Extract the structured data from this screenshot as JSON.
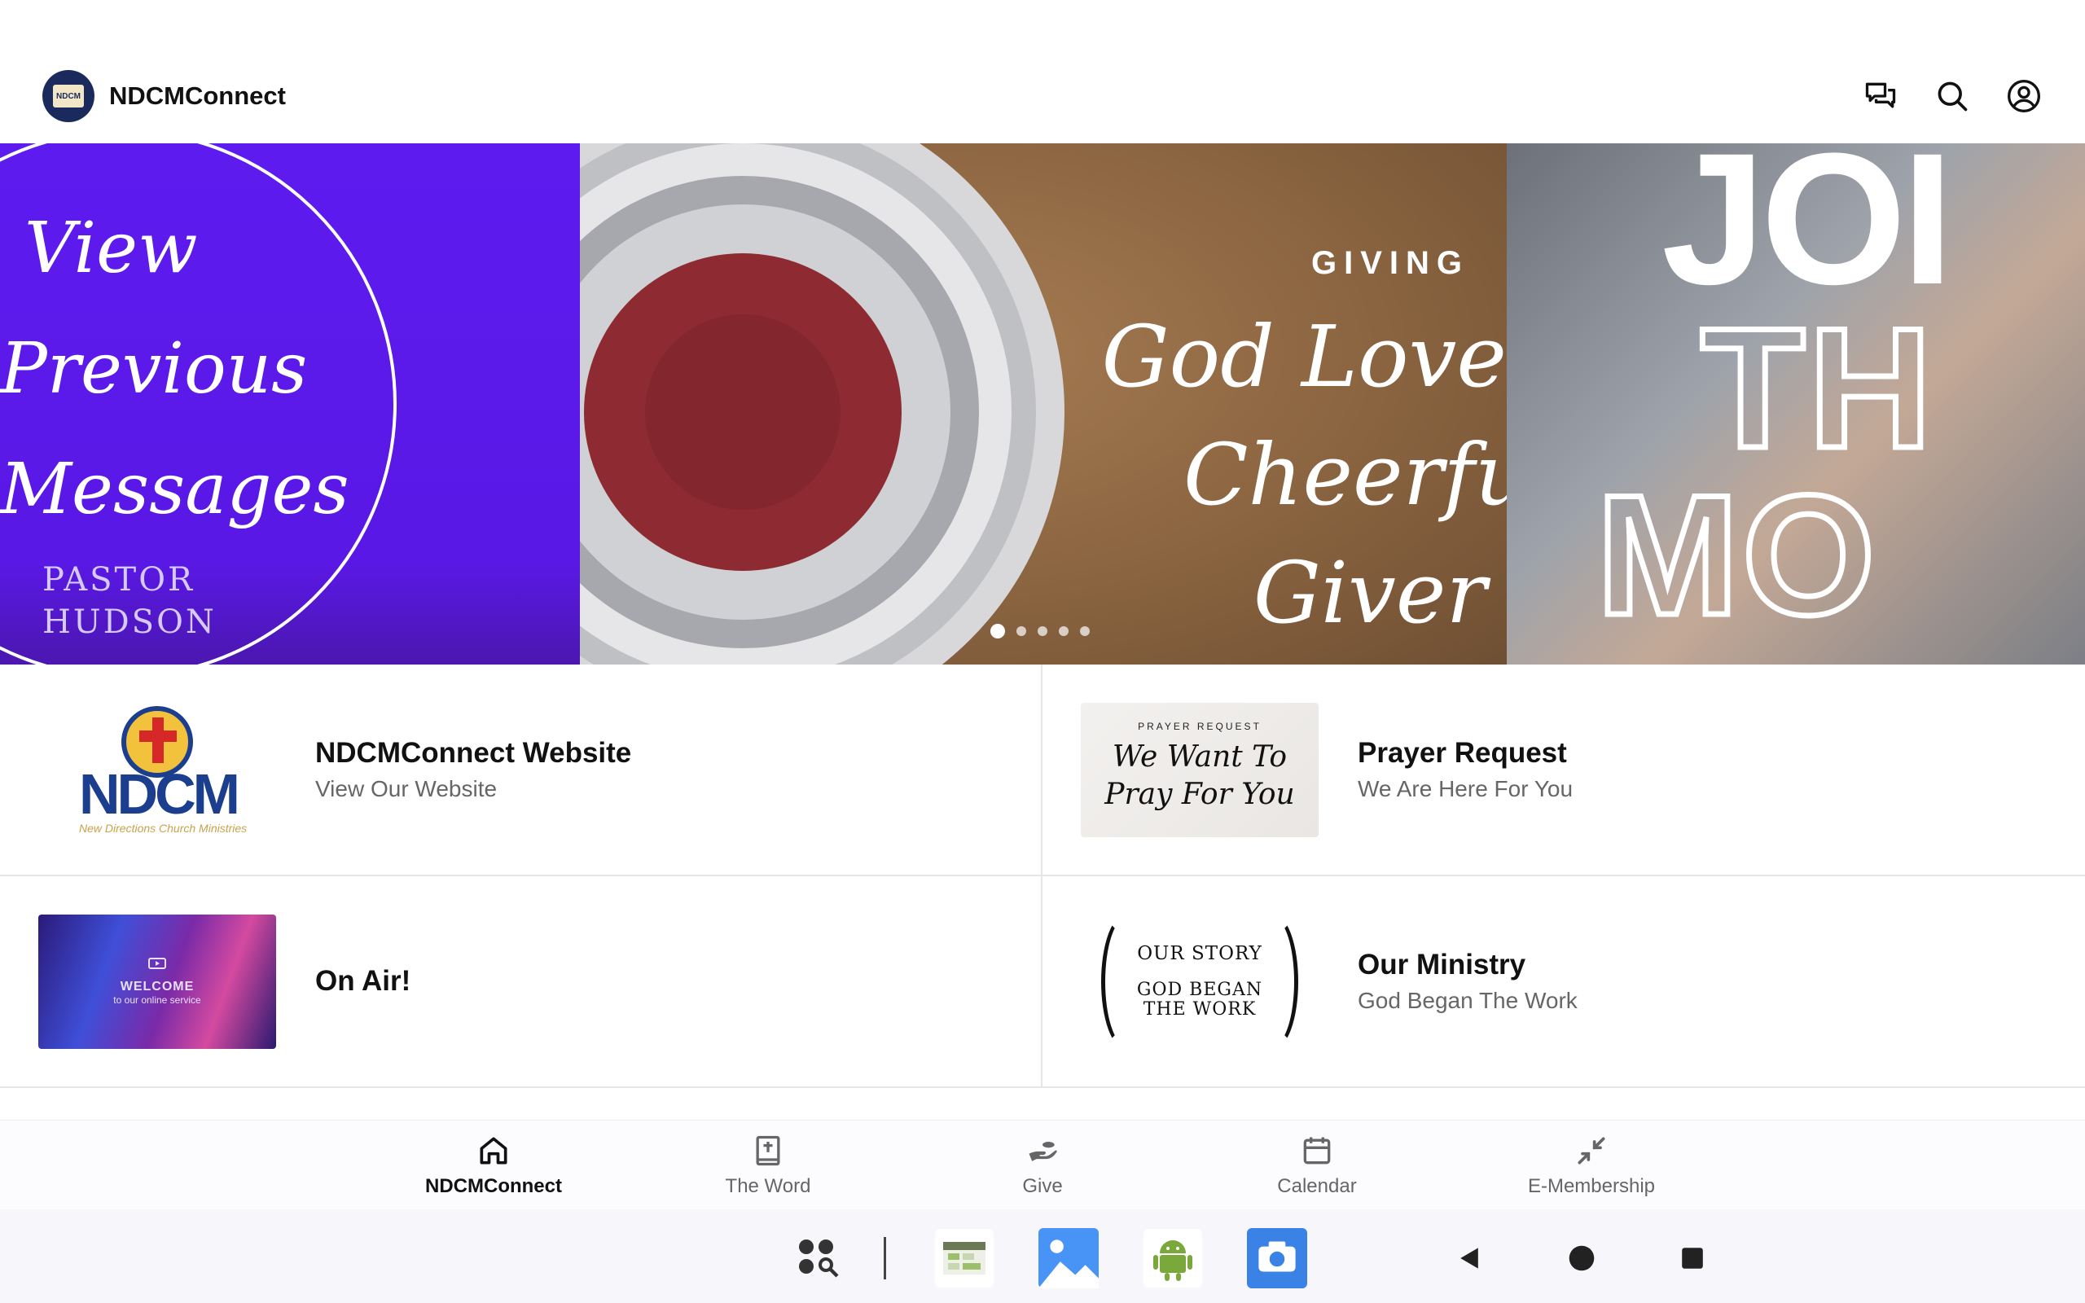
{
  "app": {
    "title": "NDCMConnect",
    "logo_text": "NDCM"
  },
  "header_actions": {
    "chat_icon": "chat-bubbles-icon",
    "search_icon": "search-icon",
    "profile_icon": "account-circle-icon"
  },
  "carousel": {
    "slides": [
      {
        "lines": [
          "View",
          "Previous",
          "Messages"
        ],
        "sub_lines": [
          "PASTOR",
          "HUDSON"
        ],
        "color": "#5d1bef"
      },
      {
        "label": "GIVING",
        "lines": [
          "God Loves A",
          "Cheerful",
          "Giver"
        ]
      },
      {
        "lines": [
          "JOI",
          "TH",
          "MO"
        ]
      }
    ],
    "active_index": 0,
    "dot_count": 5
  },
  "cards": [
    {
      "title": "NDCMConnect Website",
      "subtitle": "View Our Website",
      "thumb": {
        "word": "NDCM",
        "tagline": "New Directions Church Ministries"
      }
    },
    {
      "title": "Prayer Request",
      "subtitle": "We Are Here For You",
      "thumb": {
        "label": "PRAYER REQUEST",
        "lines": [
          "We Want To",
          "Pray For You"
        ]
      }
    },
    {
      "title": "On Air!",
      "subtitle": "",
      "thumb": {
        "welcome": "WELCOME",
        "sub": "to our online service"
      }
    },
    {
      "title": "Our Ministry",
      "subtitle": "God Began The Work",
      "thumb": {
        "line1": "OUR STORY",
        "line2": "GOD BEGAN",
        "line3": "THE WORK"
      }
    }
  ],
  "bottom_nav": {
    "items": [
      {
        "label": "NDCMConnect",
        "icon": "home-icon",
        "active": true
      },
      {
        "label": "The Word",
        "icon": "bible-icon",
        "active": false
      },
      {
        "label": "Give",
        "icon": "giving-hand-icon",
        "active": false
      },
      {
        "label": "Calendar",
        "icon": "calendar-icon",
        "active": false
      },
      {
        "label": "E-Membership",
        "icon": "collapse-arrows-icon",
        "active": false
      }
    ]
  },
  "system_bar": {
    "apps": [
      "app-drawer-icon",
      "sheets-app-icon",
      "gallery-app-icon",
      "android-app-icon",
      "camera-app-icon"
    ],
    "nav": [
      "back-icon",
      "home-circle-icon",
      "recents-icon"
    ]
  },
  "colors": {
    "accent": "#111111",
    "muted": "#666666",
    "promo_purple": "#5d1bef",
    "camera_blue": "#3b82e6"
  }
}
